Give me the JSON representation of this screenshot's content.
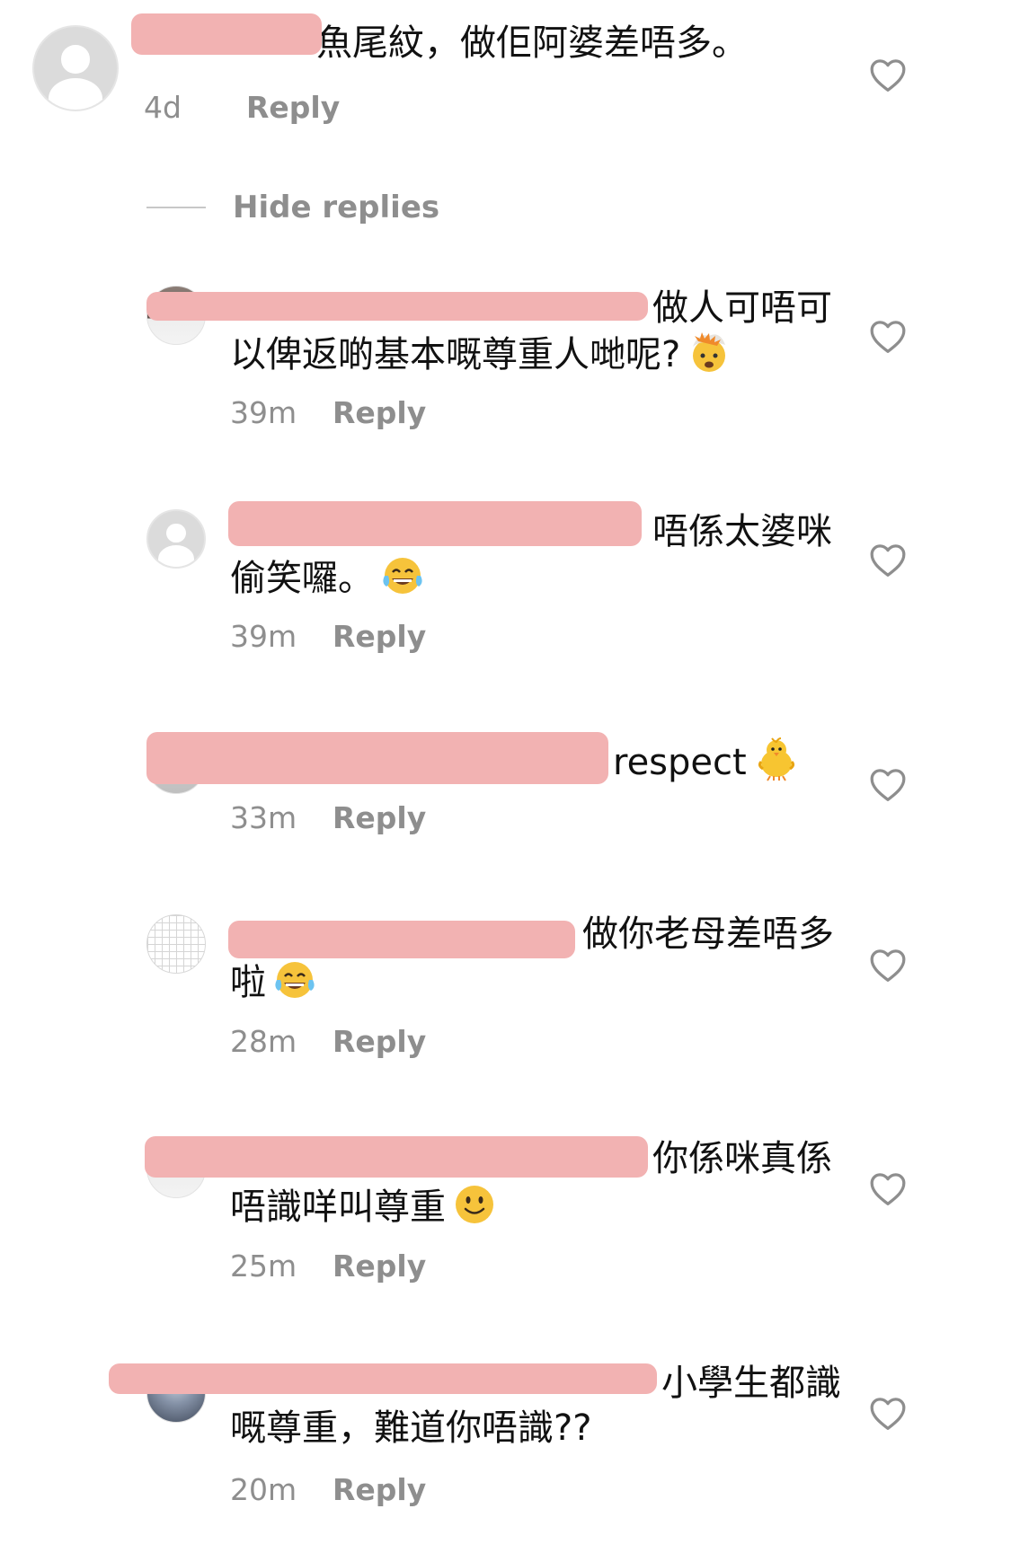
{
  "comments": [
    {
      "kind": "parent",
      "text": "魚尾紋，做佢阿婆差唔多。",
      "time": "4d",
      "reply_label": "Reply"
    }
  ],
  "hide_replies_label": "Hide replies",
  "replies": [
    {
      "text_line1": "做人可唔可",
      "text_line2": "以俾返啲基本嘅尊重人哋呢?",
      "emoji": "exploding-head-emoji",
      "time": "39m",
      "reply_label": "Reply"
    },
    {
      "text_line1": "唔係太婆咪",
      "text_line2": "偷笑囉。",
      "emoji": "tears-of-joy-emoji",
      "time": "39m",
      "reply_label": "Reply"
    },
    {
      "text_line1": "respect",
      "emoji": "baby-chick-emoji",
      "time": "33m",
      "reply_label": "Reply"
    },
    {
      "text_line1": "做你老母差唔多",
      "text_line2": "啦",
      "emoji": "tears-of-joy-emoji",
      "time": "28m",
      "reply_label": "Reply"
    },
    {
      "text_line1": "你係咪真係",
      "text_line2": "唔識咩叫尊重",
      "emoji": "slightly-smiling-face-emoji",
      "time": "25m",
      "reply_label": "Reply"
    },
    {
      "text_line1": "小學生都識",
      "text_line2": "嘅尊重，難道你唔識??",
      "time": "20m",
      "reply_label": "Reply"
    }
  ],
  "icons": {
    "like": "heart-outline-icon",
    "avatar_placeholder": "default-avatar-icon"
  },
  "colors": {
    "text": "#111111",
    "meta": "#8e8e8e",
    "redaction": "#f2b2b2",
    "divider": "#c7c7c7"
  }
}
